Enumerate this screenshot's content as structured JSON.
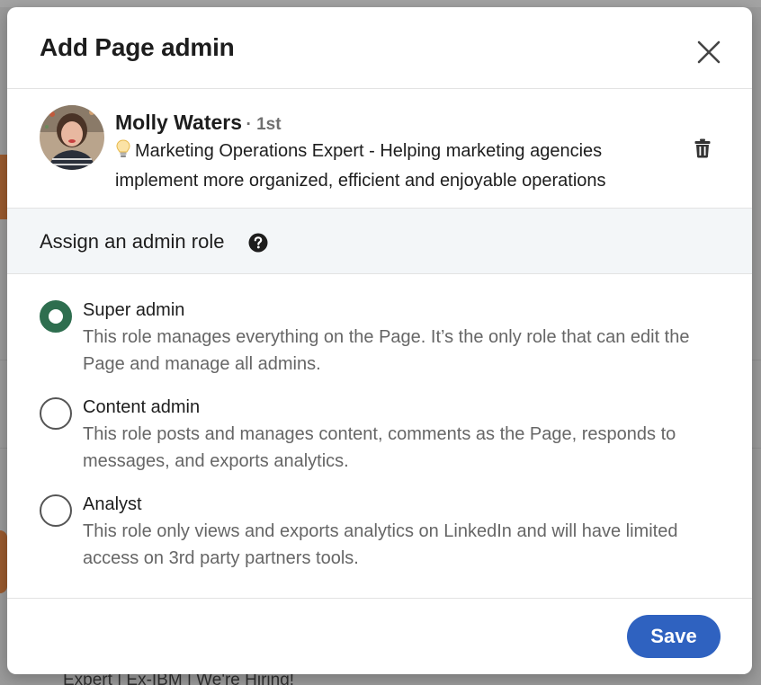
{
  "background": {
    "snippet": "Expert | Ex-IBM | We're Hiring!"
  },
  "dialog": {
    "title": "Add Page admin",
    "close_icon": "close-icon"
  },
  "person": {
    "name": "Molly Waters",
    "degree": "· 1st",
    "headline_icon": "lightbulb-icon",
    "headline": "Marketing Operations Expert - Helping marketing agencies implement more organized, efficient and enjoyable operations",
    "remove_icon": "trash-icon"
  },
  "role_section": {
    "label": "Assign an admin role",
    "help_icon": "question-circle-icon"
  },
  "roles": [
    {
      "title": "Super admin",
      "description": "This role manages everything on the Page. It’s the only role that can edit the Page and manage all admins.",
      "selected": true
    },
    {
      "title": "Content admin",
      "description": "This role posts and manages content, comments as the Page, responds to messages, and exports analytics.",
      "selected": false
    },
    {
      "title": "Analyst",
      "description": "This role only views and exports analytics on LinkedIn and will have limited access on 3rd party partners tools.",
      "selected": false
    }
  ],
  "footer": {
    "save_label": "Save"
  },
  "colors": {
    "primary_button": "#2f62c0",
    "radio_selected": "#2e6e4f",
    "section_bg": "#f3f6f8"
  }
}
